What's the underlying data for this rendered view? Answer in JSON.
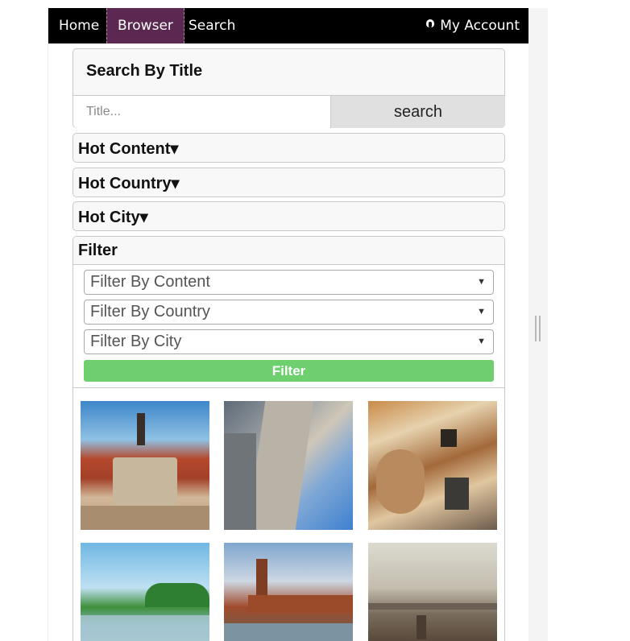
{
  "nav": {
    "home": "Home",
    "browser": "Browser",
    "search": "Search",
    "account": "My Account",
    "account_icon": "user-icon",
    "active_tab": "Browser",
    "active_color": "#5a2850"
  },
  "search_panel": {
    "title": "Search By Title",
    "input_placeholder": "Title...",
    "input_value": "",
    "button_label": "search"
  },
  "accordions": [
    {
      "label": "Hot Content▾"
    },
    {
      "label": "Hot Country▾"
    },
    {
      "label": "Hot City▾"
    }
  ],
  "filter": {
    "title": "Filter",
    "selects": [
      {
        "value": "Filter By Content",
        "icon": "chevron-down-icon"
      },
      {
        "value": "Filter By Country",
        "icon": "chevron-down-icon"
      },
      {
        "value": "Filter By City",
        "icon": "chevron-down-icon"
      }
    ],
    "arrow_glyph": "▼",
    "button_label": "Filter",
    "button_color": "#6ecf6e"
  },
  "gallery": {
    "images": [
      {
        "name": "photo-thumbnail-1"
      },
      {
        "name": "photo-thumbnail-2"
      },
      {
        "name": "photo-thumbnail-3"
      },
      {
        "name": "photo-thumbnail-4"
      },
      {
        "name": "photo-thumbnail-5"
      },
      {
        "name": "photo-thumbnail-6"
      }
    ]
  }
}
